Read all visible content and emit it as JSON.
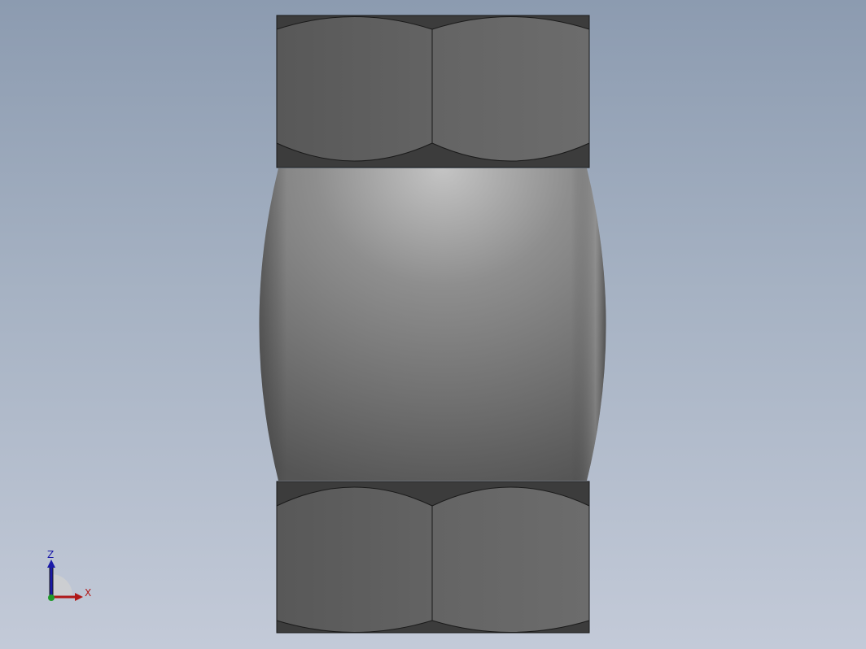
{
  "viewport": {
    "model_name": "cad-part-top-view"
  },
  "triad": {
    "z_label": "Z",
    "x_label": "X",
    "colors": {
      "z_axis": "#1a1aa8",
      "x_axis": "#b01818",
      "y_dot": "#1f9a2a"
    }
  }
}
